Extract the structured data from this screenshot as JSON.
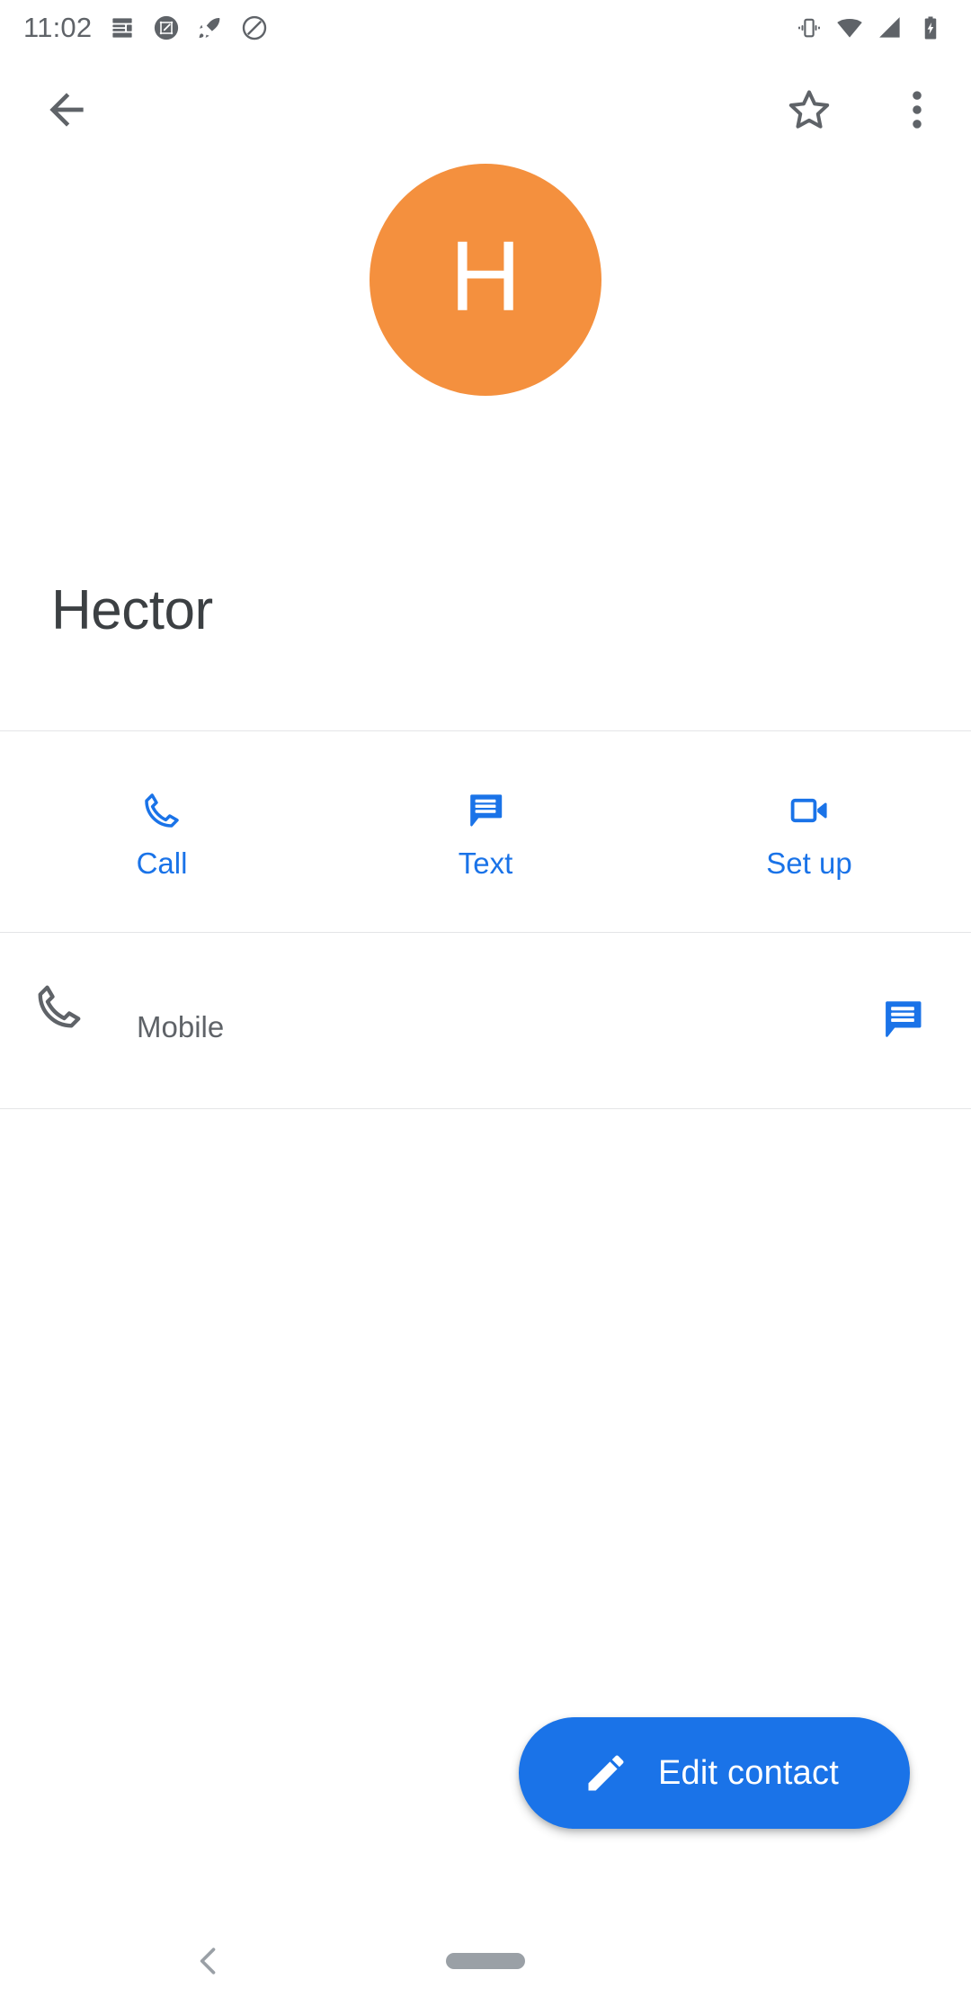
{
  "status_bar": {
    "clock": "11:02",
    "left_icons": [
      {
        "name": "notes-notification-icon"
      },
      {
        "name": "screenshot-edit-notification-icon"
      },
      {
        "name": "rocket-notification-icon"
      },
      {
        "name": "do-not-disturb-notification-icon"
      }
    ],
    "right_icons": [
      {
        "name": "vibrate-mode-icon"
      },
      {
        "name": "wifi-icon"
      },
      {
        "name": "cellular-signal-icon"
      },
      {
        "name": "battery-charging-icon"
      }
    ],
    "icon_color": "#5f6368"
  },
  "app_bar": {
    "back_label": "Navigate up",
    "star_label": "Add to favorites",
    "more_label": "More options",
    "icon_color": "#5f6368"
  },
  "contact": {
    "name": "Hector",
    "avatar_letter": "H",
    "avatar_color": "#F4903E",
    "avatar_text_color": "#ffffff"
  },
  "quick_actions": {
    "accent_color": "#1a73e8",
    "items": [
      {
        "label": "Call",
        "icon": "phone-icon"
      },
      {
        "label": "Text",
        "icon": "message-icon"
      },
      {
        "label": "Set up",
        "icon": "video-camera-icon"
      }
    ]
  },
  "phone_row": {
    "number": "",
    "label": "Mobile",
    "lead_icon": "phone-icon",
    "action_icon": "message-icon",
    "action_color": "#1a73e8"
  },
  "fab": {
    "label": "Edit contact",
    "icon": "pencil-icon",
    "background": "#1a73e8",
    "text_color": "#ffffff"
  },
  "nav_bar": {
    "back_label": "Back",
    "home_pill_label": "Home",
    "color": "#9aa0a6"
  }
}
